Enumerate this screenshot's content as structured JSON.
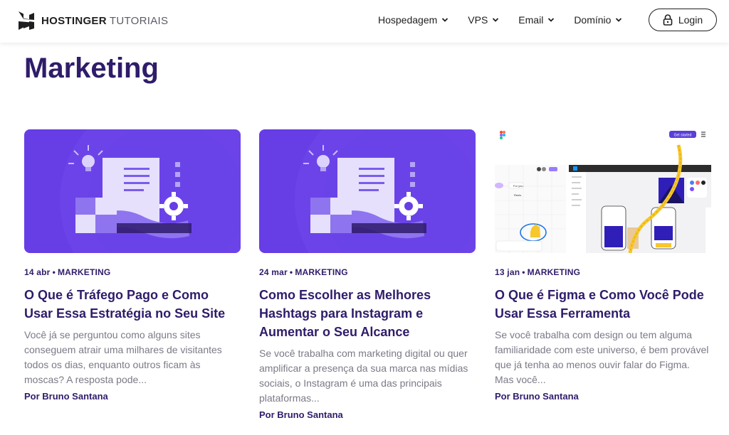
{
  "header": {
    "logo_text": "HOSTINGER",
    "logo_sub": "TUTORIAIS",
    "nav": [
      {
        "label": "Hospedagem"
      },
      {
        "label": "VPS"
      },
      {
        "label": "Email"
      },
      {
        "label": "Domínio"
      }
    ],
    "login_label": "Login"
  },
  "page_title": "Marketing",
  "cards": [
    {
      "date": "14 abr",
      "category": "MARKETING",
      "title": "O Que é Tráfego Pago e Como Usar Essa Estratégia no Seu Site",
      "excerpt": "Você já se perguntou como alguns sites conseguem atrair uma milhares de visitantes todos os dias, enquanto outros ficam às moscas? A resposta pode...",
      "author": "Por Bruno Santana"
    },
    {
      "date": "24 mar",
      "category": "MARKETING",
      "title": "Como Escolher as Melhores Hashtags para Instagram e Aumentar o Seu Alcance",
      "excerpt": "Se você trabalha com marketing digital ou quer amplificar a presença da sua marca nas mídias sociais, o Instagram é uma das principais plataformas...",
      "author": "Por Bruno Santana"
    },
    {
      "date": "13 jan",
      "category": "MARKETING",
      "title": "O Que é Figma e Como Você Pode Usar Essa Ferramenta",
      "excerpt": "Se você trabalha com design ou tem alguma familiaridade com este universo, é bem provável que já tenha ao menos ouvir falar do Figma. Mas você...",
      "author": "Por Bruno Santana",
      "thumb_text": {
        "get_started": "Get started",
        "for_you": "For you",
        "reels": "Reels"
      }
    }
  ],
  "colors": {
    "brand_purple": "#673de6",
    "heading": "#2f1c6a",
    "text_muted": "#7b7a87"
  }
}
